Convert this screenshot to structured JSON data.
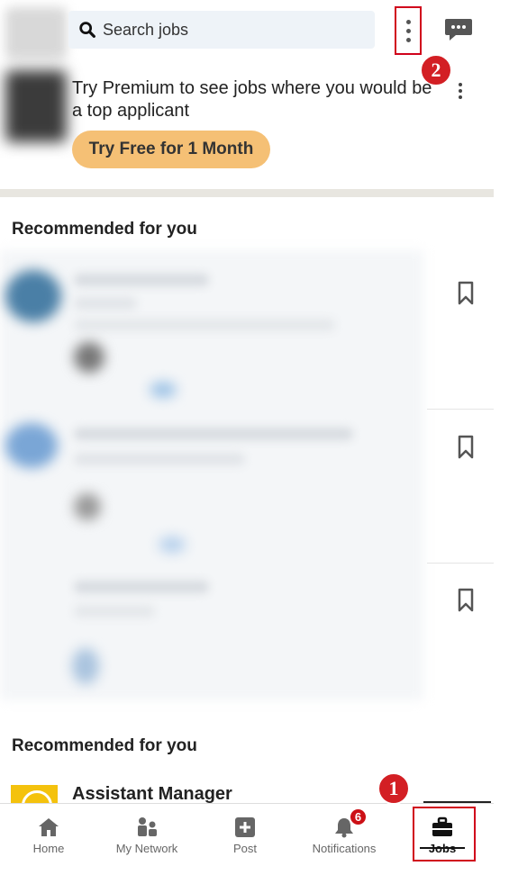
{
  "header": {
    "search_placeholder": "Search jobs",
    "overflow_menu": "more-options-icon",
    "messaging": "messaging-icon"
  },
  "promo": {
    "text": "Try Premium to see jobs where you would be a top applicant",
    "cta_label": "Try Free for 1 Month",
    "cta_color": "#f5c075"
  },
  "sections": [
    {
      "title": "Recommended for you"
    },
    {
      "title": "Recommended for you"
    }
  ],
  "visible_job": {
    "title": "Assistant Manager"
  },
  "annotations": {
    "badge_1": "1",
    "badge_2": "2",
    "highlight_color": "#d0021b"
  },
  "bottom_nav": {
    "items": [
      {
        "label": "Home",
        "icon": "home-icon"
      },
      {
        "label": "My Network",
        "icon": "network-icon"
      },
      {
        "label": "Post",
        "icon": "post-icon"
      },
      {
        "label": "Notifications",
        "icon": "bell-icon",
        "badge": "6"
      },
      {
        "label": "Jobs",
        "icon": "briefcase-icon",
        "active": true
      }
    ]
  }
}
